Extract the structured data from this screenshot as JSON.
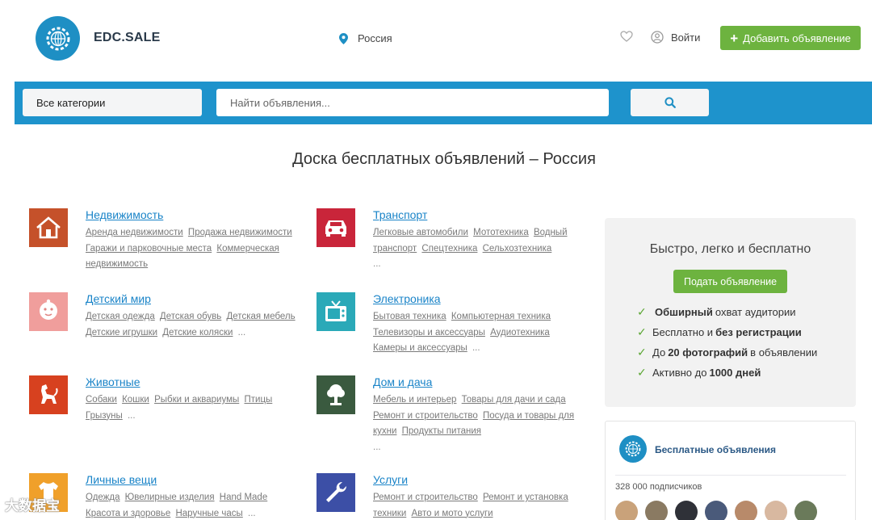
{
  "header": {
    "brand": "EDC.SALE",
    "location": "Россия",
    "login_label": "Войти",
    "add_button_label": "Добавить объявление"
  },
  "search": {
    "category_value": "Все категории",
    "placeholder": "Найти объявления..."
  },
  "page_title": "Доска бесплатных объявлений – Россия",
  "categories": [
    {
      "title": "Недвижимость",
      "subs": [
        "Аренда недвижимости",
        "Продажа недвижимости",
        "Гаражи и парковочные места",
        "Коммерческая недвижимость"
      ],
      "more": ""
    },
    {
      "title": "Транспорт",
      "subs": [
        "Легковые автомобили",
        "Мототехника",
        "Водный транспорт",
        "Спецтехника",
        "Сельхозтехника"
      ],
      "more": "..."
    },
    {
      "title": "Детский мир",
      "subs": [
        "Детская одежда",
        "Детская обувь",
        "Детская мебель",
        "Детские игрушки",
        "Детские коляски"
      ],
      "more": "..."
    },
    {
      "title": "Электроника",
      "subs": [
        "Бытовая техника",
        "Компьютерная техника",
        "Телевизоры и аксессуары",
        "Аудиотехника",
        "Камеры и аксессуары"
      ],
      "more": "..."
    },
    {
      "title": "Животные",
      "subs": [
        "Собаки",
        "Кошки",
        "Рыбки и аквариумы",
        "Птицы",
        "Грызуны"
      ],
      "more": "..."
    },
    {
      "title": "Дом и дача",
      "subs": [
        "Мебель и интерьер",
        "Товары для дачи и сада",
        "Ремонт и строительство",
        "Посуда и товары для кухни",
        "Продукты питания"
      ],
      "more": "..."
    },
    {
      "title": "Личные вещи",
      "subs": [
        "Одежда",
        "Ювелирные изделия",
        "Hand Made",
        "Красота и здоровье",
        "Наручные часы"
      ],
      "more": "..."
    },
    {
      "title": "Услуги",
      "subs": [
        "Ремонт и строительство",
        "Ремонт и установка техники",
        "Авто и мото услуги"
      ],
      "more": ""
    }
  ],
  "promo": {
    "title": "Быстро, легко и бесплатно",
    "button_label": "Подать объявление",
    "items": [
      {
        "pre": "",
        "bold": "Обширный",
        "post": "охват аудитории"
      },
      {
        "pre": "Бесплатно и",
        "bold": "без регистрации",
        "post": ""
      },
      {
        "pre": "До",
        "bold": "20 фотографий",
        "post": "в объявлении"
      },
      {
        "pre": "Активно до",
        "bold": "1000 дней",
        "post": ""
      }
    ]
  },
  "vk_widget": {
    "name": "Бесплатные объявления",
    "subscribers": "328 000 подписчиков"
  },
  "watermark": "大数据宝",
  "icons": {
    "location": "map-pin-icon",
    "favorites": "heart-icon",
    "user": "user-circle-icon",
    "search": "search-icon"
  },
  "colors": {
    "accent_blue": "#1e93cc",
    "accent_green": "#6db33f",
    "link_blue": "#1a84c8"
  }
}
